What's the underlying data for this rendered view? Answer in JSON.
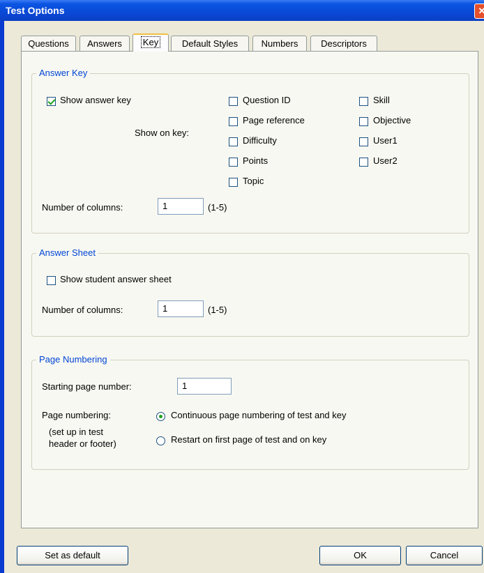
{
  "window": {
    "title": "Test Options"
  },
  "tabs": [
    "Questions",
    "Answers",
    "Key",
    "Default Styles",
    "Numbers",
    "Descriptors"
  ],
  "answer_key": {
    "title": "Answer Key",
    "show_answer_key_label": "Show answer key",
    "show_answer_key_checked": true,
    "show_on_key_label": "Show on key:",
    "options_col1": [
      "Question ID",
      "Page reference",
      "Difficulty",
      "Points",
      "Topic"
    ],
    "options_col2": [
      "Skill",
      "Objective",
      "User1",
      "User2"
    ],
    "columns_label": "Number of columns:",
    "columns_value": "1",
    "columns_range": "(1-5)"
  },
  "answer_sheet": {
    "title": "Answer Sheet",
    "show_sheet_label": "Show student answer sheet",
    "columns_label": "Number of columns:",
    "columns_value": "1",
    "columns_range": "(1-5)"
  },
  "page_numbering": {
    "title": "Page Numbering",
    "start_label": "Starting page number:",
    "start_value": "1",
    "numbering_label": "Page numbering:",
    "numbering_note_1": "(set up in test",
    "numbering_note_2": "header or footer)",
    "option_continuous": "Continuous page numbering of test and key",
    "option_restart": "Restart on first page of test and on key",
    "selected": "continuous"
  },
  "buttons": {
    "set_default": "Set as default",
    "ok": "OK",
    "cancel": "Cancel"
  },
  "colors": {
    "title_bar": "#0a48d6",
    "group_title": "#0046d5",
    "dialog_bg": "#ece9d8"
  }
}
